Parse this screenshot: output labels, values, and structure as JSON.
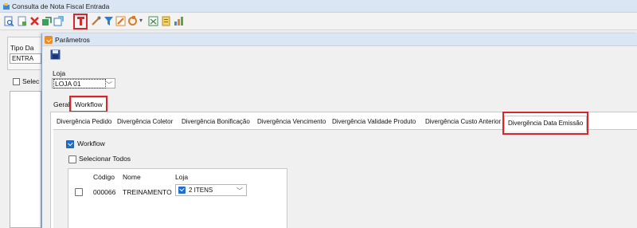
{
  "background_window": {
    "title": "Consulta de Nota Fiscal Entrada",
    "tipo_label": "Tipo Da",
    "tipo_value": "ENTRA",
    "select_label": "Selec"
  },
  "dialog": {
    "title": "Parâmetros",
    "loja_label": "Loja",
    "loja_value": "LOJA 01"
  },
  "tabs": [
    {
      "label": "Geral"
    },
    {
      "label": "Workflow"
    }
  ],
  "subtabs": [
    {
      "label": "Divergência Pedido"
    },
    {
      "label": "Divergência Coletor"
    },
    {
      "label": "Divergência Bonificação"
    },
    {
      "label": "Divergência Vencimento"
    },
    {
      "label": "Divergência Validade Produto"
    },
    {
      "label": "Divergência Custo Anterior"
    },
    {
      "label": "Divergência Data Emissão"
    }
  ],
  "workflow": {
    "workflow_label": "Workflow",
    "select_all_label": "Selecionar Todos"
  },
  "grid": {
    "columns": [
      "Código",
      "Nome",
      "Loja"
    ],
    "rows": [
      {
        "codigo": "000066",
        "nome": "TREINAMENTO",
        "loja": "2 ITENS"
      }
    ]
  },
  "colors": {
    "highlight_red": "#d9262c",
    "check_blue": "#1f6fcf"
  },
  "icons": [
    "search-icon",
    "new-document-icon",
    "delete-icon",
    "export-icon",
    "print-icon",
    "config-icon",
    "tool-icon",
    "filter-icon",
    "edit-icon",
    "refresh-icon",
    "excel-icon",
    "report-icon",
    "chart-icon",
    "save-icon"
  ]
}
